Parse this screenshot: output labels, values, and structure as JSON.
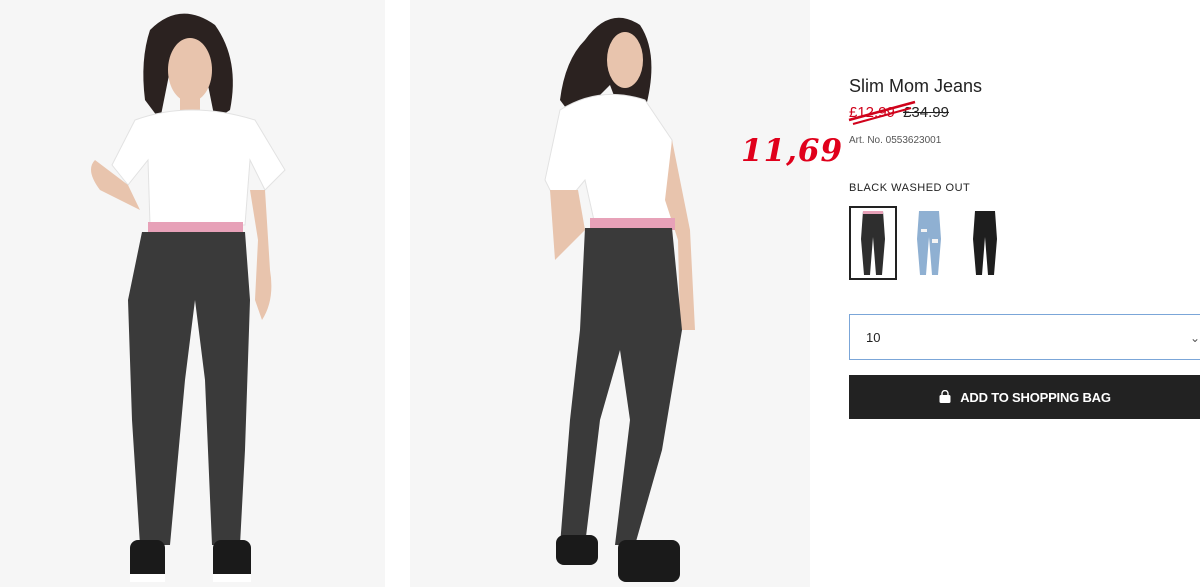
{
  "product": {
    "title": "Slim Mom Jeans",
    "sale_price": "£12.99",
    "old_price": "£34.99",
    "art_no": "Art. No. 0553623001",
    "annotation": "11,69"
  },
  "images": [
    {
      "name": "front-view-photo",
      "view": "front"
    },
    {
      "name": "back-view-photo",
      "view": "back"
    }
  ],
  "color": {
    "label": "BLACK WASHED OUT",
    "swatches": [
      {
        "name": "black-washed-out",
        "fill": "#2e2e2e",
        "selected": true
      },
      {
        "name": "light-blue-ripped",
        "fill": "#8fb0d2",
        "selected": false
      },
      {
        "name": "black",
        "fill": "#1e1e1e",
        "selected": false
      }
    ]
  },
  "size": {
    "selected": "10",
    "chevron": "⌄"
  },
  "cart": {
    "add_label": "ADD TO SHOPPING BAG",
    "icon": "shopping-bag-icon"
  },
  "colors": {
    "sale_red": "#d0021b",
    "annotation_red": "#e0001b",
    "button_bg": "#222222",
    "select_border": "#7ba6d8"
  }
}
